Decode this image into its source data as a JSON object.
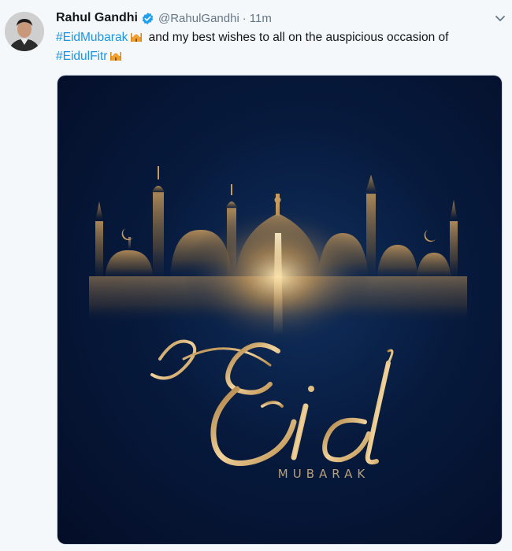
{
  "tweet": {
    "author_name": "Rahul Gandhi",
    "handle": "@RahulGandhi",
    "separator": "·",
    "time": "11m",
    "hashtag1": "#EidMubarak",
    "body_text": " and my best wishes to all on the auspicious occasion of",
    "hashtag2": "#EidulFitr"
  },
  "media": {
    "script_title": "Eid",
    "subtitle": "MUBARAK"
  },
  "icons": {
    "verified": "verified-badge-icon",
    "caret": "chevron-down-icon",
    "emoji": "mosque-emoji-icon"
  },
  "colors": {
    "link": "#1b95e0",
    "verified": "#1da1f2",
    "gold": "#d4a45a",
    "background_dark": "#071a3d"
  }
}
